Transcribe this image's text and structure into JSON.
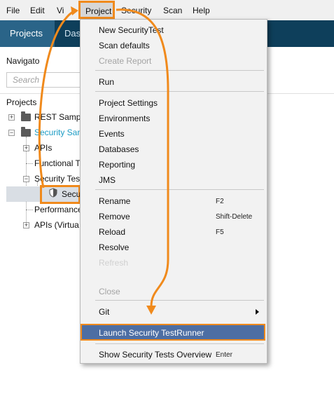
{
  "menubar": {
    "items": [
      "File",
      "Edit",
      "Vi",
      "Project",
      "Security",
      "Scan",
      "Help"
    ]
  },
  "toolbar": {
    "projects_tab": "Projects",
    "das_tab": "Das"
  },
  "navigator": {
    "title": "Navigato",
    "search_placeholder": "Search",
    "projects_label": "Projects",
    "tree": [
      "REST Sampl",
      "Security San",
      "APIs",
      "Functional T",
      "Security Tes",
      "Secu",
      "Performance",
      "APIs (Virtua"
    ]
  },
  "menu": {
    "new_security_test": "New SecurityTest",
    "scan_defaults": "Scan defaults",
    "create_report": "Create Report",
    "run": "Run",
    "project_settings": "Project Settings",
    "environments": "Environments",
    "events": "Events",
    "databases": "Databases",
    "reporting": "Reporting",
    "jms": "JMS",
    "rename": "Rename",
    "rename_shortcut": "F2",
    "remove": "Remove",
    "remove_shortcut": "Shift-Delete",
    "reload": "Reload",
    "reload_shortcut": "F5",
    "resolve": "Resolve",
    "refresh": "Refresh",
    "close": "Close",
    "git": "Git",
    "launch": "Launch Security TestRunner",
    "overview": "Show Security Tests Overview",
    "overview_shortcut": "Enter"
  },
  "colors": {
    "highlight_orange": "#f08a1c",
    "toolbar_dark": "#0e3f5b",
    "tab_active": "#2a6488",
    "menu_selected": "#4d6ea3",
    "project_link": "#1a9bc4"
  }
}
